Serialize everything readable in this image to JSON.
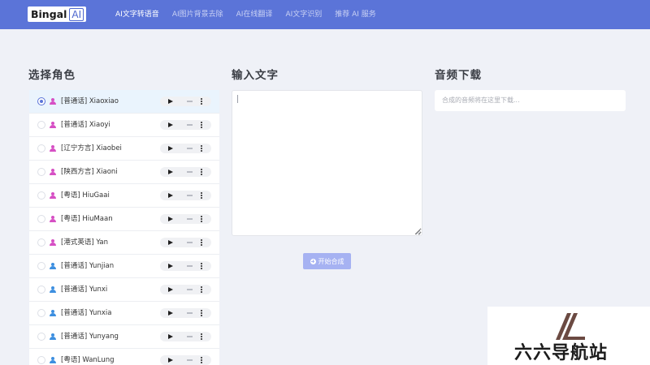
{
  "header": {
    "logo_text": "Bingal",
    "logo_badge": "AI",
    "nav": [
      "AI文字转语音",
      "AI图片背景去除",
      "AI在线翻译",
      "AI文字识别",
      "推荐 AI 服务"
    ]
  },
  "sections": {
    "voices_title": "选择角色",
    "input_title": "输入文字",
    "download_title": "音频下载"
  },
  "voices": [
    {
      "label": "[普通话] Xiaoxiao",
      "gender": "female",
      "selected": true
    },
    {
      "label": "[普通话] Xiaoyi",
      "gender": "female",
      "selected": false
    },
    {
      "label": "[辽宁方言] Xiaobei",
      "gender": "female",
      "selected": false
    },
    {
      "label": "[陕西方言] Xiaoni",
      "gender": "female",
      "selected": false
    },
    {
      "label": "[粤语] HiuGaai",
      "gender": "female",
      "selected": false
    },
    {
      "label": "[粤语] HiuMaan",
      "gender": "female",
      "selected": false
    },
    {
      "label": "[港式英语] Yan",
      "gender": "female",
      "selected": false
    },
    {
      "label": "[普通话] Yunjian",
      "gender": "male",
      "selected": false
    },
    {
      "label": "[普通话] Yunxi",
      "gender": "male",
      "selected": false
    },
    {
      "label": "[普通话] Yunxia",
      "gender": "male",
      "selected": false
    },
    {
      "label": "[普通话] Yunyang",
      "gender": "male",
      "selected": false
    },
    {
      "label": "[粤语] WanLung",
      "gender": "male",
      "selected": false
    }
  ],
  "input": {
    "value": ""
  },
  "synth_button": "开始合成",
  "download_placeholder": "合成的音频将在这里下载...",
  "watermark": {
    "text": "六六导航站"
  },
  "colors": {
    "header": "#5b74d8",
    "female_icon": "#d64fc4",
    "male_icon": "#3d8fe0",
    "button": "#a6b2f2",
    "background": "#eff1f7"
  }
}
